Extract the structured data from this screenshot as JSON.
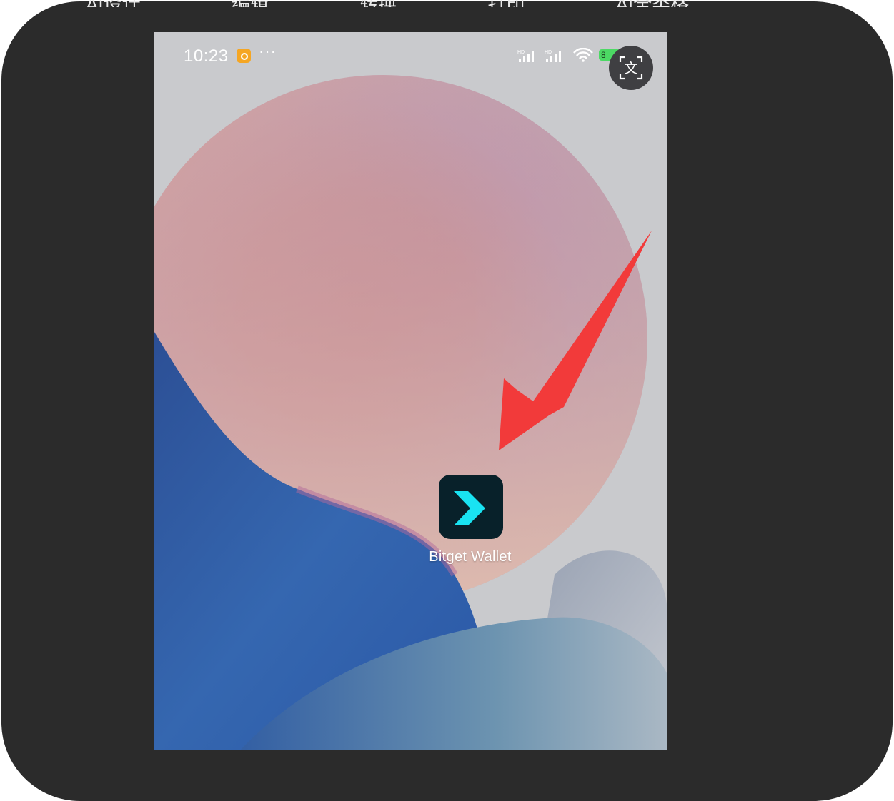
{
  "top_toolbar": {
    "items": [
      "AI设计",
      "编辑",
      "转换",
      "打印",
      "AI全类格"
    ]
  },
  "status_bar": {
    "time": "10:23",
    "more": "···",
    "signal_badge_1": "HD",
    "signal_badge_2": "HD",
    "battery_level": "8"
  },
  "translate_button": {
    "icon_char": "文"
  },
  "home_screen": {
    "app": {
      "label": "Bitget Wallet"
    }
  },
  "colors": {
    "arrow": "#f23a3a",
    "app_icon_bg": "#08212a",
    "app_icon_chevron": "#19e3f2",
    "panel": "#2b2b2b"
  }
}
